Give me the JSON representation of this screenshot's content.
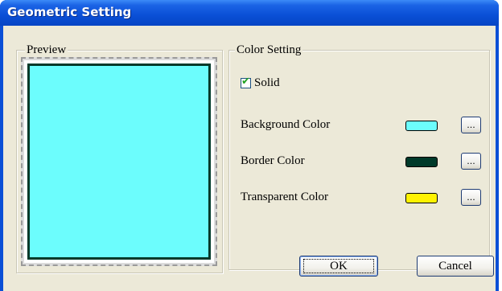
{
  "window": {
    "title": "Geometric Setting"
  },
  "preview": {
    "label": "Preview"
  },
  "color_setting": {
    "label": "Color Setting",
    "solid": {
      "label": "Solid",
      "checked": true
    },
    "rows": [
      {
        "label": "Background Color",
        "color": "#6cfdfd",
        "button": "..."
      },
      {
        "label": "Border Color",
        "color": "#003a2a",
        "button": "..."
      },
      {
        "label": "Transparent Color",
        "color": "#fff200",
        "button": "..."
      }
    ]
  },
  "buttons": {
    "ok": "OK",
    "cancel": "Cancel"
  },
  "colors": {
    "titlebar": "#0a4fd6",
    "dialog_bg": "#ece9d8"
  }
}
